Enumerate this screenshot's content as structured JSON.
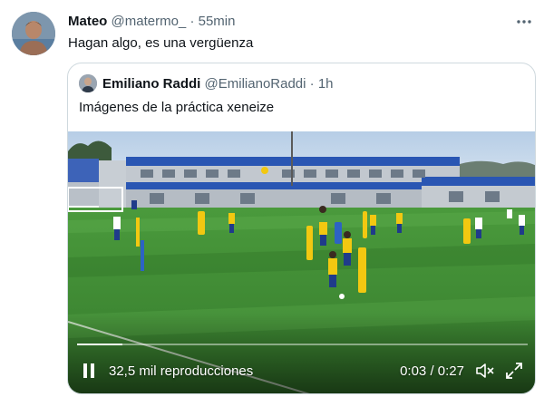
{
  "tweet": {
    "author_name": "Mateo",
    "author_handle": "@matermo_",
    "separator": "·",
    "time": "55min",
    "text": "Hagan algo, es una vergüenza"
  },
  "quoted": {
    "author_name": "Emiliano Raddi",
    "author_handle": "@EmilianoRaddi",
    "separator": "·",
    "time": "1h",
    "text": "Imágenes de la práctica xeneize"
  },
  "video": {
    "views": "32,5 mil reproducciones",
    "time_current": "0:03",
    "time_separator": "/",
    "time_total": "0:27",
    "progress_fraction": 0.1
  },
  "icons": {
    "more": "more-options-icon",
    "play_state": "pause-icon",
    "mute": "mute-icon",
    "fullscreen": "fullscreen-icon"
  },
  "colors": {
    "text": "#0f1419",
    "muted": "#536471",
    "border": "#cfd9de",
    "pitch": "#3f8b35",
    "kit_yellow": "#f2c811",
    "building_blue": "#2a56b3"
  }
}
